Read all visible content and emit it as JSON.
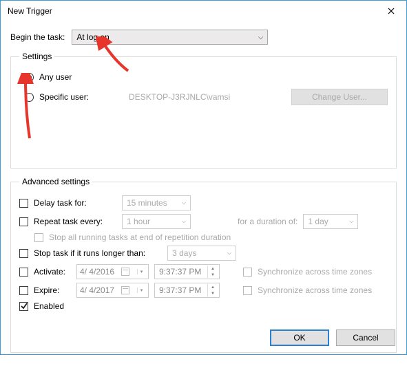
{
  "window": {
    "title": "New Trigger"
  },
  "begin": {
    "label": "Begin the task:",
    "value": "At log on"
  },
  "settings": {
    "legend": "Settings",
    "any_user": "Any user",
    "specific_user": "Specific user:",
    "user_value": "DESKTOP-J3RJNLC\\vamsi",
    "change_user": "Change User..."
  },
  "advanced": {
    "legend": "Advanced settings",
    "delay_label": "Delay task for:",
    "delay_value": "15 minutes",
    "repeat_label": "Repeat task every:",
    "repeat_value": "1 hour",
    "duration_label": "for a duration of:",
    "duration_value": "1 day",
    "stop_all": "Stop all running tasks at end of repetition duration",
    "stop_longer_label": "Stop task if it runs longer than:",
    "stop_longer_value": "3 days",
    "activate_label": "Activate:",
    "activate_date": "4/ 4/2016",
    "activate_time": "9:37:37 PM",
    "expire_label": "Expire:",
    "expire_date": "4/ 4/2017",
    "expire_time": "9:37:37 PM",
    "sync_label": "Synchronize across time zones",
    "enabled_label": "Enabled"
  },
  "footer": {
    "ok": "OK",
    "cancel": "Cancel"
  }
}
